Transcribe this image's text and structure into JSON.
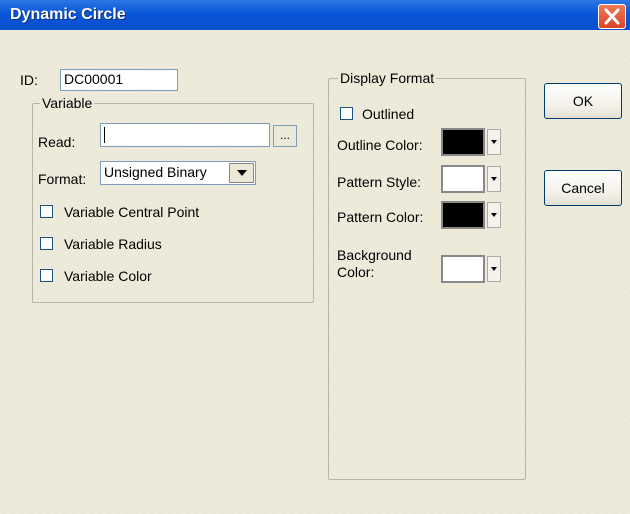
{
  "window": {
    "title": "Dynamic Circle"
  },
  "id_field": {
    "label": "ID:",
    "value": "DC00001"
  },
  "variable_group": {
    "legend": "Variable",
    "read_label": "Read:",
    "read_value": "",
    "browse_label": "...",
    "format_label": "Format:",
    "format_value": "Unsigned Binary",
    "checks": [
      {
        "label": "Variable Central Point",
        "checked": false
      },
      {
        "label": "Variable Radius",
        "checked": false
      },
      {
        "label": "Variable Color",
        "checked": false
      }
    ]
  },
  "display_group": {
    "legend": "Display Format",
    "outlined_label": "Outlined",
    "outline_color_label": "Outline Color:",
    "outline_color": "#000000",
    "pattern_style_label": "Pattern Style:",
    "pattern_style_color": "#ffffff",
    "pattern_color_label": "Pattern Color:",
    "pattern_color": "#000000",
    "background_color_label_1": "Background",
    "background_color_label_2": "Color:",
    "background_color": "#ffffff"
  },
  "buttons": {
    "ok": "OK",
    "cancel": "Cancel"
  }
}
